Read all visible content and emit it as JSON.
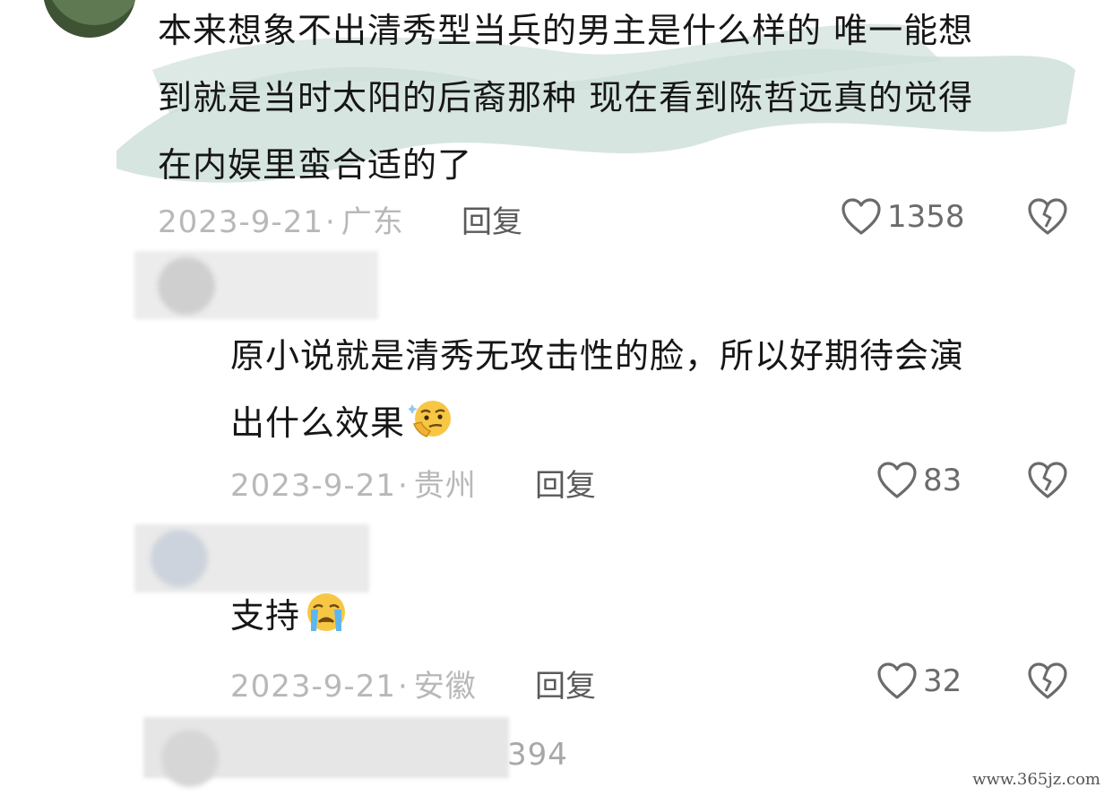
{
  "comments": [
    {
      "text_lines": [
        "本来想象不出清秀型当兵的男主是什么样的 唯一能想",
        "到就是当时太阳的后裔那种 现在看到陈哲远真的觉得",
        "在内娱里蛮合适的了"
      ],
      "date": "2023-9-21",
      "location": "广东",
      "reply_label": "回复",
      "likes": "1358"
    },
    {
      "text_lines": [
        "原小说就是清秀无攻击性的脸，所以好期待会演",
        "出什么效果"
      ],
      "emoji": "thinking-face-emoji",
      "date": "2023-9-21",
      "location": "贵州",
      "reply_label": "回复",
      "likes": "83"
    },
    {
      "text_lines": [
        "支持"
      ],
      "emoji": "crying-face-emoji",
      "date": "2023-9-21",
      "location": "安徽",
      "reply_label": "回复",
      "likes": "32"
    }
  ],
  "partial_count": "394",
  "watermark": "www.365jz.com",
  "colors": {
    "brush": "#cfe0d9",
    "meta_gray": "#b8b8b8",
    "icon_gray": "#6b6b6b"
  }
}
